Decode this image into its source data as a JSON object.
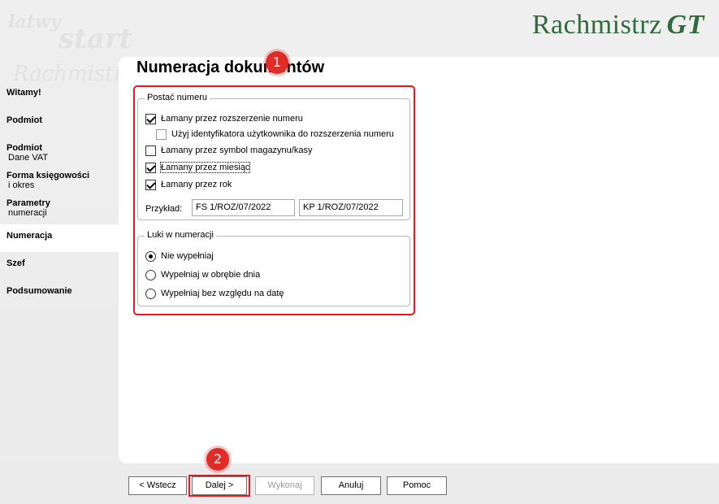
{
  "header": {
    "deco_words": [
      "łatwy",
      "start",
      "Rachmistrz"
    ],
    "logo_text": "Rachmistrz",
    "logo_suffix": "GT",
    "logo_color": "#2f6b3c"
  },
  "sidebar": {
    "items": [
      {
        "label": "Witamy!",
        "sub": ""
      },
      {
        "label": "Podmiot",
        "sub": ""
      },
      {
        "label": "Podmiot",
        "sub": "Dane VAT"
      },
      {
        "label": "Forma księgowości",
        "sub": "i okres"
      },
      {
        "label": "Parametry",
        "sub": "numeracji"
      },
      {
        "label": "Numeracja",
        "sub": ""
      },
      {
        "label": "Szef",
        "sub": ""
      },
      {
        "label": "Podsumowanie",
        "sub": ""
      }
    ],
    "active_index": 5
  },
  "main": {
    "title": "Numeracja dokumentów",
    "badge1": "1",
    "badge2": "2",
    "postac": {
      "title": "Postać numeru",
      "options": [
        {
          "label": "Łamany przez rozszerzenie numeru",
          "checked": true
        },
        {
          "label": "Użyj identyfikatora użytkownika do rozszerzenia numeru",
          "checked": false
        },
        {
          "label": "Łamany przez symbol magazynu/kasy",
          "checked": false
        },
        {
          "label": "Łamany przez miesiąc",
          "checked": true
        },
        {
          "label": "Łamany przez rok",
          "checked": true
        }
      ],
      "example_label": "Przykład:",
      "example1": "FS 1/ROZ/07/2022",
      "example2": "KP 1/ROZ/07/2022"
    },
    "luki": {
      "title": "Luki w numeracji",
      "options": [
        {
          "label": "Nie wypełniaj",
          "selected": true
        },
        {
          "label": "Wypełniaj w obrębie dnia",
          "selected": false
        },
        {
          "label": "Wypełniaj bez względu na datę",
          "selected": false
        }
      ]
    }
  },
  "buttons": {
    "back": "< Wstecz",
    "next": "Dalej >",
    "execute": "Wykonaj",
    "cancel": "Anuluj",
    "help": "Pomoc"
  },
  "colors": {
    "highlight": "#e21b23",
    "badge": "#e02b27"
  }
}
